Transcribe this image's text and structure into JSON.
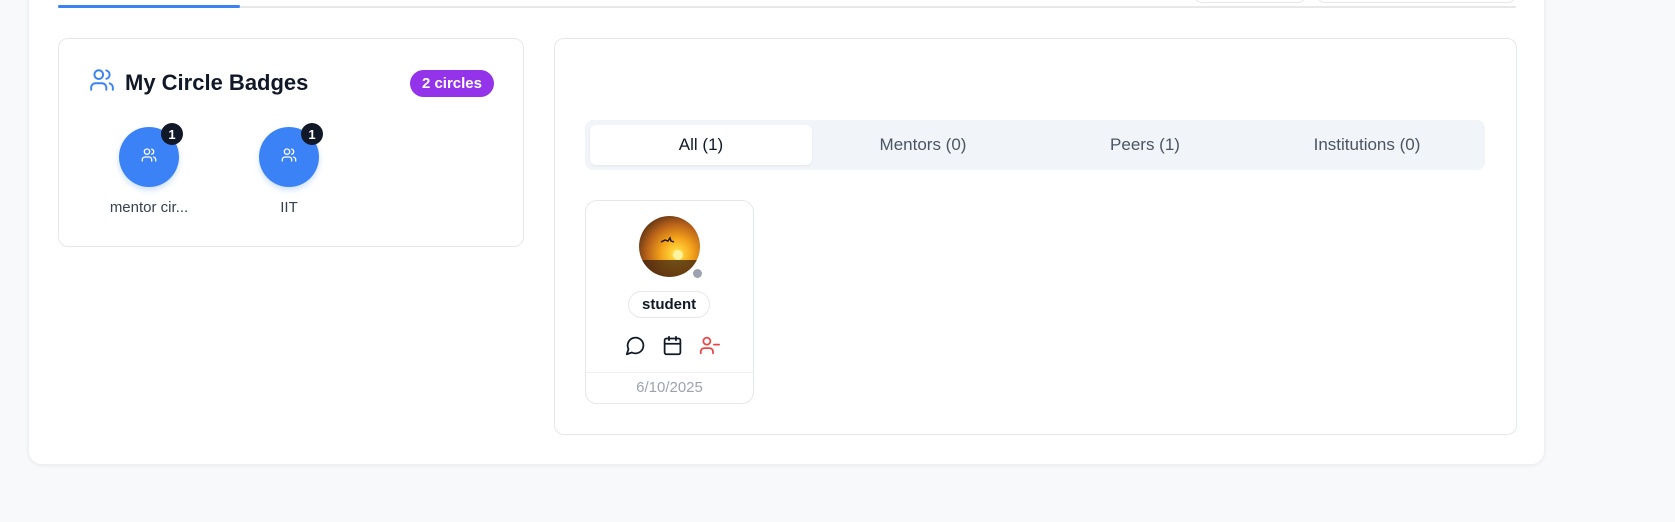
{
  "badges": {
    "title": "My Circle Badges",
    "count_label": "2 circles",
    "items": [
      {
        "label": "mentor cir...",
        "count": "1"
      },
      {
        "label": "IIT",
        "count": "1"
      }
    ]
  },
  "connections": {
    "filters": [
      {
        "label": "All (1)",
        "active": true
      },
      {
        "label": "Mentors (0)",
        "active": false
      },
      {
        "label": "Peers (1)",
        "active": false
      },
      {
        "label": "Institutions (0)",
        "active": false
      }
    ],
    "people": [
      {
        "role": "student",
        "date": "6/10/2025",
        "status": "offline"
      }
    ]
  },
  "colors": {
    "accent": "#3b82f6",
    "pill_purple": "#9333ea",
    "remove_red": "#ef4444"
  },
  "icons": {
    "header": "users-icon",
    "badge": "users-icon",
    "message": "message-circle-icon",
    "calendar": "calendar-icon",
    "remove": "user-minus-icon"
  }
}
